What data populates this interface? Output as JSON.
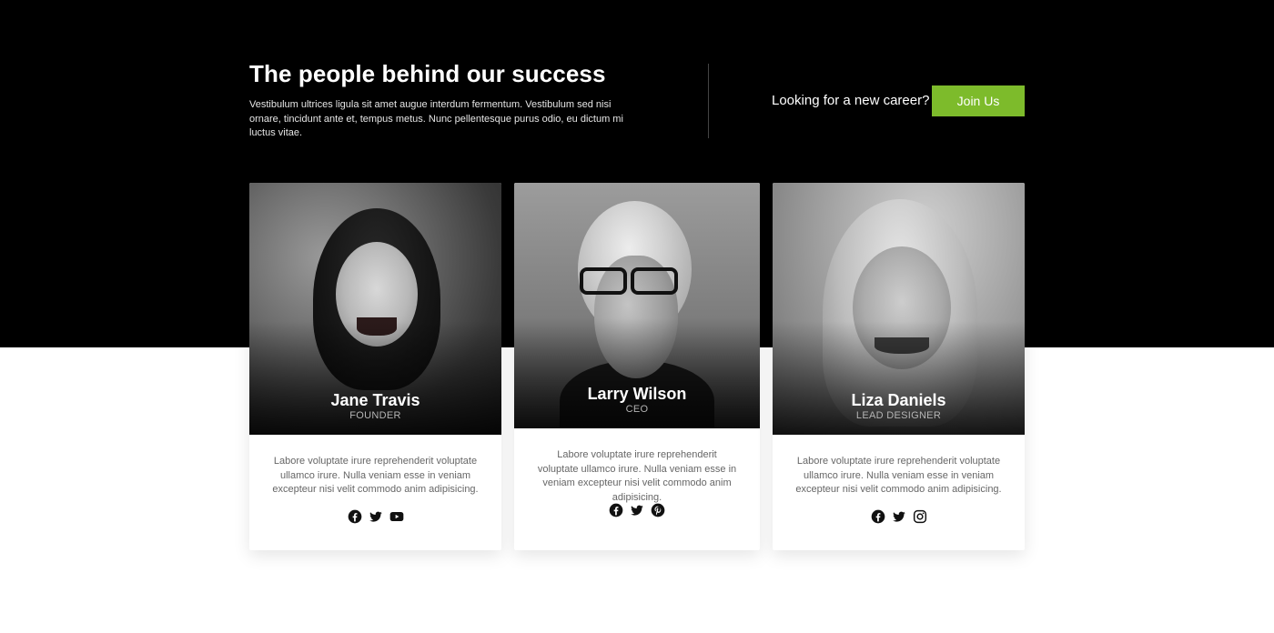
{
  "hero": {
    "title": "The people behind our success",
    "description": "Vestibulum ultrices ligula sit amet augue interdum fermentum. Vestibulum sed nisi ornare, tincidunt ante et, tempus metus. Nunc pellentesque purus odio, eu dictum mi luctus vitae.",
    "career_text": "Looking for a new career?",
    "join_label": "Join Us",
    "accent_color": "#7dbb2b"
  },
  "team": [
    {
      "name": "Jane Travis",
      "role": "FOUNDER",
      "bio": "Labore voluptate irure reprehenderit voluptate ullamco irure. Nulla veniam esse in veniam excepteur nisi velit commodo anim adipisicing.",
      "socials": [
        "facebook-icon",
        "twitter-icon",
        "youtube-icon"
      ]
    },
    {
      "name": "Larry Wilson",
      "role": "CEO",
      "bio": "Labore voluptate irure reprehenderit voluptate ullamco irure. Nulla veniam esse in veniam excepteur nisi velit commodo anim adipisicing.",
      "socials": [
        "facebook-icon",
        "twitter-icon",
        "pinterest-icon"
      ]
    },
    {
      "name": "Liza Daniels",
      "role": "LEAD DESIGNER",
      "bio": "Labore voluptate irure reprehenderit voluptate ullamco irure. Nulla veniam esse in veniam excepteur nisi velit commodo anim adipisicing.",
      "socials": [
        "facebook-icon",
        "twitter-icon",
        "instagram-icon"
      ]
    }
  ]
}
